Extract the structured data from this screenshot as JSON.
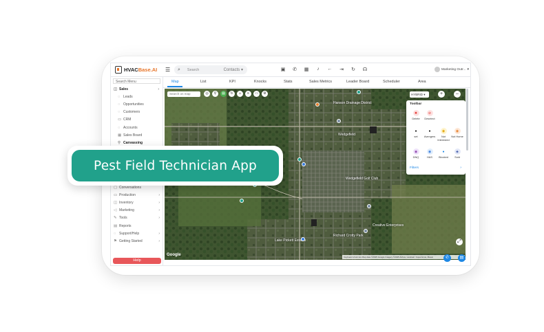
{
  "overlay": {
    "title": "Pest Field Technician App"
  },
  "app": {
    "brand_prefix": "HVAC",
    "brand_suffix": "Base.AI"
  },
  "topbar": {
    "search_placeholder": "Search",
    "search_scope": "Contacts",
    "user_name": "Marketing Outr..."
  },
  "sidebar": {
    "search_placeholder": "Search Menu",
    "sales_label": "Sales",
    "sales_items": [
      "Leads",
      "Opportunities",
      "Customers",
      "CRM",
      "Accounts",
      "Sales Board",
      "Canvassing"
    ],
    "lower_items": [
      "Conversations",
      "Production",
      "Inventory",
      "Marketing",
      "Tools",
      "Reports",
      "Support/Help",
      "Getting Started"
    ],
    "help_label": "Help"
  },
  "tabs": [
    "Map",
    "List",
    "KPI",
    "Knocks",
    "Stats",
    "Sales Metrics",
    "Leader Board",
    "Scheduler",
    "Area"
  ],
  "map": {
    "search_placeholder": "Search on map",
    "map_type": "HYBRID",
    "google_label": "Google",
    "attribution": "Keyboard shortcuts   Map data ©2025 Google Imagery ©2025 Airbus, Landsat / Copernicus, Maxar",
    "labels": [
      "Wedgefield",
      "Lake Pickett Estates",
      "Richard Crotty Park",
      "Creative Enterprises",
      "Hanson Drainage District",
      "Wedgefield Golf Club"
    ]
  },
  "toolbar": {
    "title": "Toolbar",
    "items": [
      "Delete",
      "Deselect",
      "set",
      "Avengers",
      "Not Interested",
      "Not Home",
      "DNQ",
      "HAS",
      "Blocked",
      "Sold"
    ],
    "filters_label": "Filters"
  }
}
